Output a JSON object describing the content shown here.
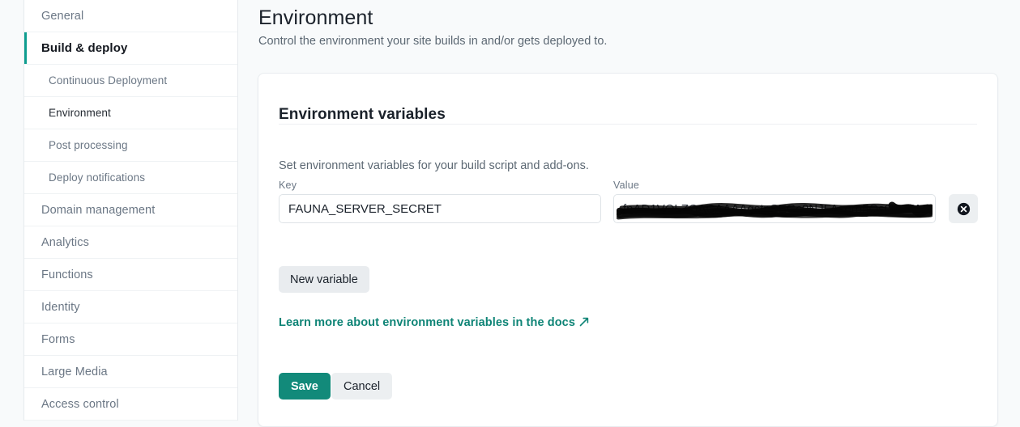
{
  "page": {
    "title": "Environment",
    "subtitle": "Control the environment your site builds in and/or gets deployed to."
  },
  "sidebar": {
    "items": [
      {
        "label": "General",
        "level": 1,
        "state": "default"
      },
      {
        "label": "Build & deploy",
        "level": 1,
        "state": "active-parent"
      },
      {
        "label": "Continuous Deployment",
        "level": 2,
        "state": "default"
      },
      {
        "label": "Environment",
        "level": 2,
        "state": "active-child"
      },
      {
        "label": "Post processing",
        "level": 2,
        "state": "default"
      },
      {
        "label": "Deploy notifications",
        "level": 2,
        "state": "default"
      },
      {
        "label": "Domain management",
        "level": 1,
        "state": "default"
      },
      {
        "label": "Analytics",
        "level": 1,
        "state": "default"
      },
      {
        "label": "Functions",
        "level": 1,
        "state": "default"
      },
      {
        "label": "Identity",
        "level": 1,
        "state": "default"
      },
      {
        "label": "Forms",
        "level": 1,
        "state": "default"
      },
      {
        "label": "Large Media",
        "level": 1,
        "state": "default"
      },
      {
        "label": "Access control",
        "level": 1,
        "state": "default"
      }
    ]
  },
  "card": {
    "title": "Environment variables",
    "description": "Set environment variables for your build script and add-ons.",
    "key_label": "Key",
    "value_label": "Value",
    "key_value": "FAUNA_SERVER_SECRET",
    "key_placeholder": "",
    "value_value": "fnAD1VOLZOACAAAAgstpSEGc0NJFAsorn5Qs0rnT9MW",
    "value_placeholder": "",
    "value_redacted": true,
    "delete_icon": "circle-x-icon",
    "new_variable_label": "New variable",
    "docs_link_label": "Learn more about environment variables in the docs",
    "docs_link_icon": "external-link-icon",
    "save_label": "Save",
    "cancel_label": "Cancel"
  },
  "colors": {
    "accent_teal": "#128a7a",
    "link_teal": "#0e8476",
    "page_bg": "#f8fafb",
    "card_bg": "#ffffff",
    "muted_text": "#6b7785",
    "heading_text": "#1b222b"
  }
}
